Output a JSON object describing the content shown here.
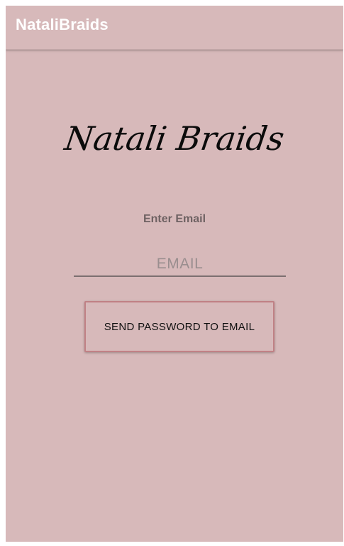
{
  "app_bar": {
    "title": "NataliBraids"
  },
  "main": {
    "logo_text": "Natali Braids",
    "prompt_label": "Enter Email",
    "email_input": {
      "value": "",
      "placeholder": "EMAIL"
    },
    "send_button_label": "SEND PASSWORD TO EMAIL"
  },
  "colors": {
    "background": "#d7b9ba",
    "app_bar_text": "#ffffff",
    "button_border": "#c08185",
    "label_text": "#6f6263",
    "input_underline": "#7c6f70"
  }
}
